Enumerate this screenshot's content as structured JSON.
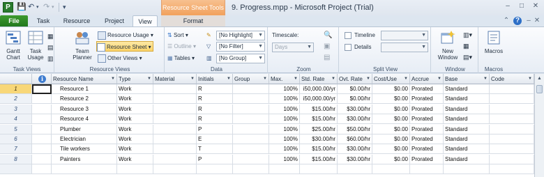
{
  "titlebar": {
    "app_icon_letter": "P",
    "contextual_group": "Resource Sheet Tools",
    "window_title": "9. Progress.mpp  -  Microsoft Project (Trial)"
  },
  "tabs": [
    {
      "label": "File"
    },
    {
      "label": "Task"
    },
    {
      "label": "Resource"
    },
    {
      "label": "Project"
    },
    {
      "label": "View"
    },
    {
      "label": "Format"
    }
  ],
  "ribbon": {
    "task_views": {
      "label": "Task Views",
      "gantt_chart": "Gantt\nChart",
      "task_usage": "Task\nUsage"
    },
    "resource_views": {
      "label": "Resource Views",
      "team_planner": "Team\nPlanner",
      "resource_usage": "Resource Usage",
      "resource_sheet": "Resource Sheet",
      "other_views": "Other Views"
    },
    "data": {
      "label": "Data",
      "sort": "Sort",
      "outline": "Outline",
      "tables": "Tables",
      "highlight_value": "[No Highlight]",
      "filter_value": "[No Filter]",
      "group_value": "[No Group]"
    },
    "zoom": {
      "label": "Zoom",
      "timescale": "Timescale:",
      "timescale_value": "Days"
    },
    "split_view": {
      "label": "Split View",
      "timeline": "Timeline",
      "details": "Details"
    },
    "window": {
      "label": "Window",
      "new_window": "New\nWindow"
    },
    "macros": {
      "label": "Macros",
      "macros_btn": "Macros"
    }
  },
  "grid": {
    "columns": [
      "",
      "Resource Name",
      "Type",
      "Material",
      "Initials",
      "Group",
      "Max.",
      "Std. Rate",
      "Ovt. Rate",
      "Cost/Use",
      "Accrue",
      "Base",
      "Code"
    ],
    "rows": [
      {
        "id": "1",
        "name": "Resource 1",
        "type": "Work",
        "material": "",
        "initials": "R",
        "group": "",
        "max": "100%",
        "std": "i50,000.00/yr",
        "ovt": "$0.00/hr",
        "cost": "$0.00",
        "accrue": "Prorated",
        "base": "Standard",
        "code": ""
      },
      {
        "id": "2",
        "name": "Resource 2",
        "type": "Work",
        "material": "",
        "initials": "R",
        "group": "",
        "max": "100%",
        "std": "i50,000.00/yr",
        "ovt": "$0.00/hr",
        "cost": "$0.00",
        "accrue": "Prorated",
        "base": "Standard",
        "code": ""
      },
      {
        "id": "3",
        "name": "Resource 3",
        "type": "Work",
        "material": "",
        "initials": "R",
        "group": "",
        "max": "100%",
        "std": "$15.00/hr",
        "ovt": "$30.00/hr",
        "cost": "$0.00",
        "accrue": "Prorated",
        "base": "Standard",
        "code": ""
      },
      {
        "id": "4",
        "name": "Resource 4",
        "type": "Work",
        "material": "",
        "initials": "R",
        "group": "",
        "max": "100%",
        "std": "$15.00/hr",
        "ovt": "$30.00/hr",
        "cost": "$0.00",
        "accrue": "Prorated",
        "base": "Standard",
        "code": ""
      },
      {
        "id": "5",
        "name": "Plumber",
        "type": "Work",
        "material": "",
        "initials": "P",
        "group": "",
        "max": "100%",
        "std": "$25.00/hr",
        "ovt": "$50.00/hr",
        "cost": "$0.00",
        "accrue": "Prorated",
        "base": "Standard",
        "code": ""
      },
      {
        "id": "6",
        "name": "Electrician",
        "type": "Work",
        "material": "",
        "initials": "E",
        "group": "",
        "max": "100%",
        "std": "$30.00/hr",
        "ovt": "$60.00/hr",
        "cost": "$0.00",
        "accrue": "Prorated",
        "base": "Standard",
        "code": ""
      },
      {
        "id": "7",
        "name": "Tile workers",
        "type": "Work",
        "material": "",
        "initials": "T",
        "group": "",
        "max": "100%",
        "std": "$15.00/hr",
        "ovt": "$30.00/hr",
        "cost": "$0.00",
        "accrue": "Prorated",
        "base": "Standard",
        "code": ""
      },
      {
        "id": "8",
        "name": "Painters",
        "type": "Work",
        "material": "",
        "initials": "P",
        "group": "",
        "max": "100%",
        "std": "$15.00/hr",
        "ovt": "$30.00/hr",
        "cost": "$0.00",
        "accrue": "Prorated",
        "base": "Standard",
        "code": ""
      }
    ]
  },
  "colors": {
    "file_tab": "#2a8a25",
    "contextual_tab": "#f2a15c",
    "selected_row": "#f8d778",
    "selected_button": "#fbd46a"
  }
}
